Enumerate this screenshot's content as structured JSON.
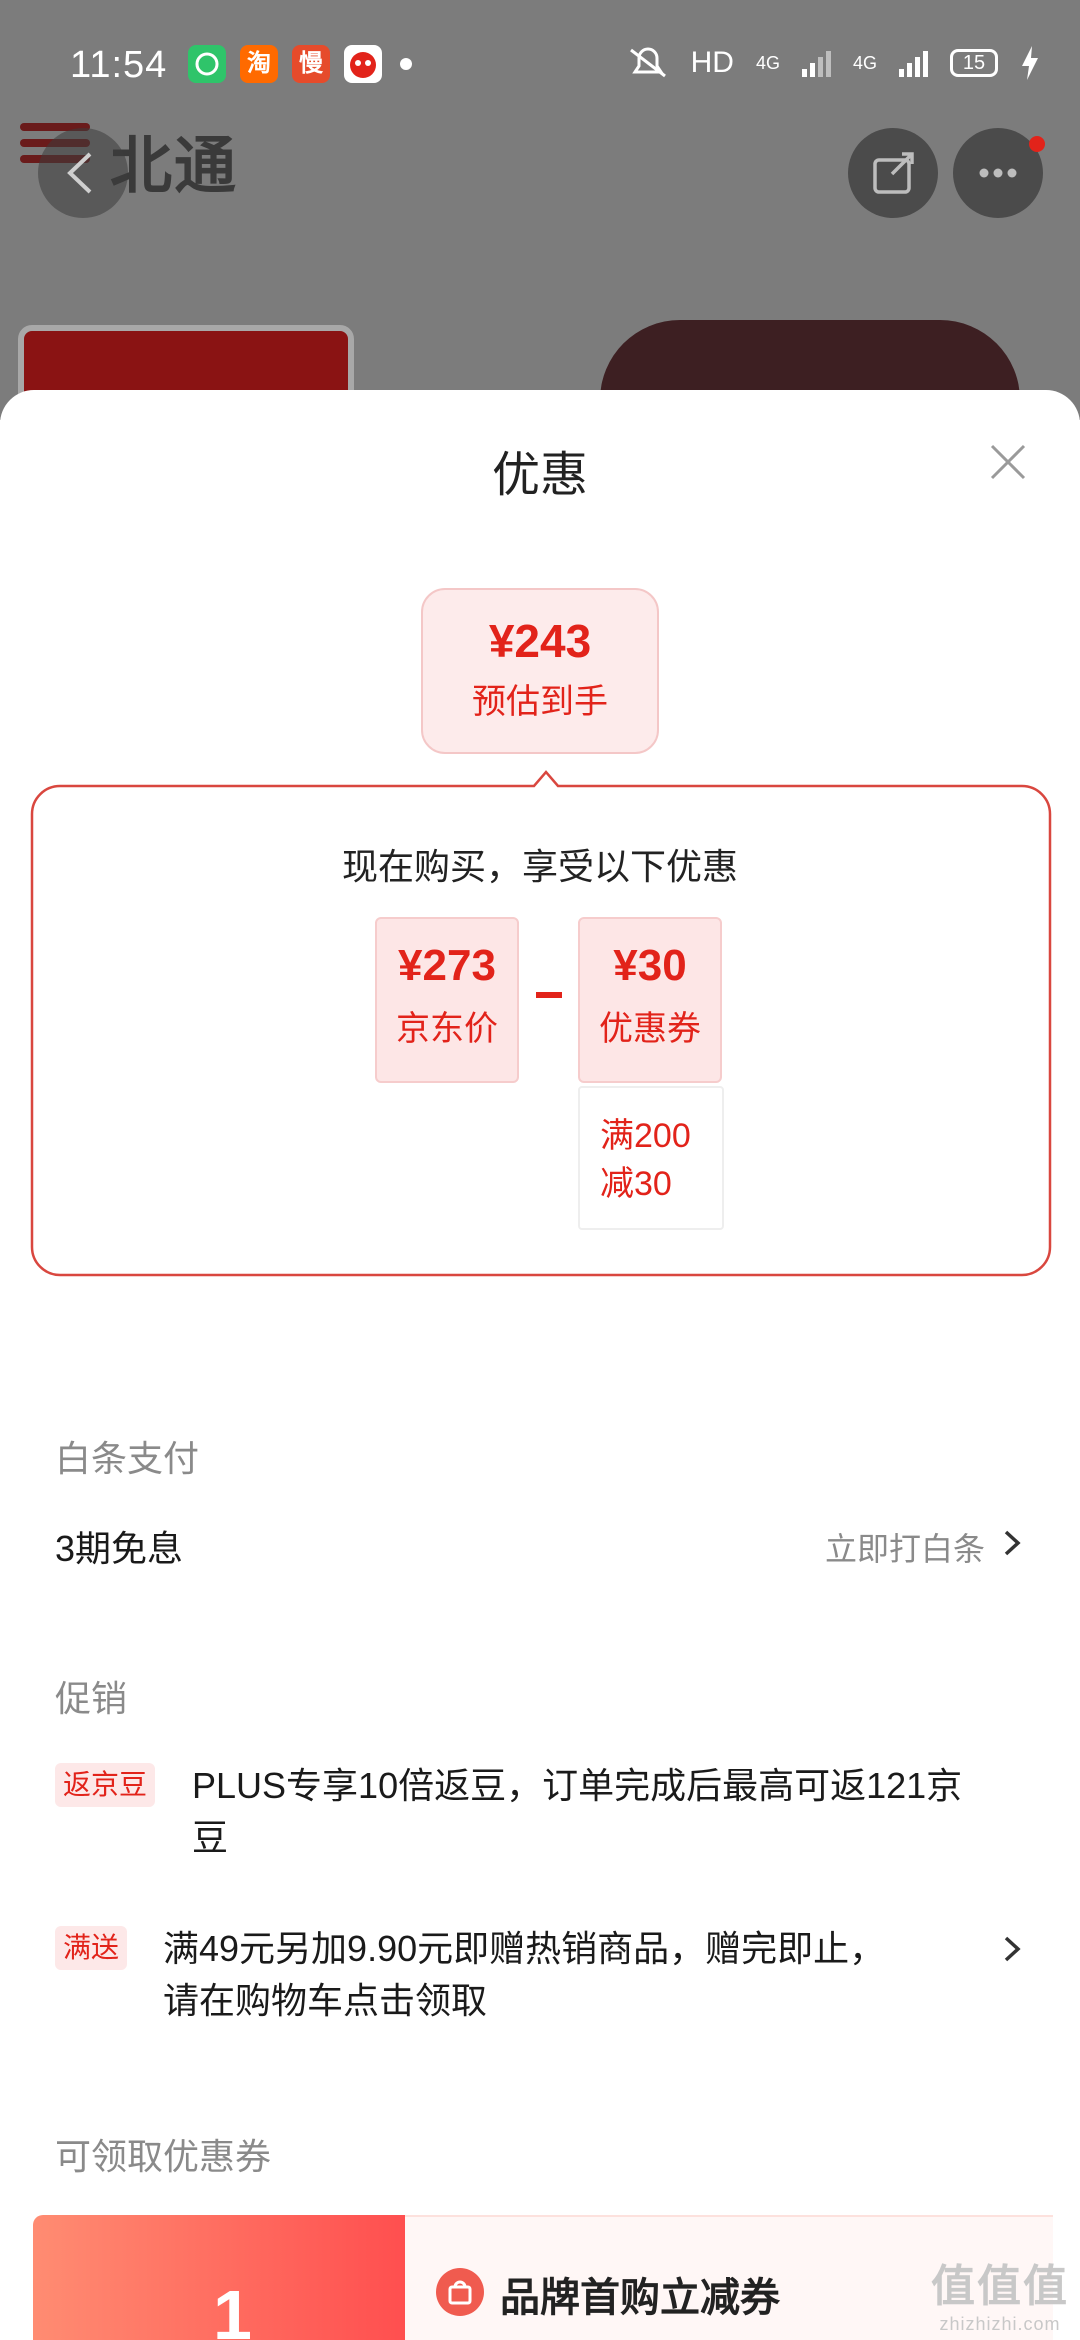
{
  "status_bar": {
    "time": "11:54",
    "apps": [
      "wechat-icon",
      "taobao-icon",
      "app-icon",
      "jd-mascot-icon"
    ],
    "app_badge_text": [
      "淘",
      "慢"
    ],
    "network": "HD",
    "net_type_1": "4G",
    "net_type_2": "4G",
    "battery": "15"
  },
  "background_page": {
    "brand_name": "北通"
  },
  "sheet": {
    "title": "优惠",
    "estimate": {
      "price": "¥243",
      "label": "预估到手"
    },
    "calc_title": "现在购买，享受以下优惠",
    "jd_price": {
      "value": "¥273",
      "label": "京东价"
    },
    "coupon": {
      "value": "¥30",
      "label": "优惠券",
      "condition_line1": "满200",
      "condition_line2": "减30"
    },
    "baitiao": {
      "section": "白条支付",
      "item": "3期免息",
      "action": "立即打白条"
    },
    "promotion": {
      "section": "促销",
      "items": [
        {
          "tag": "返京豆",
          "line1": "PLUS专享10倍返豆，订单完成后最高可返121京",
          "line2": "豆"
        },
        {
          "tag": "满送",
          "line1": "满49元另加9.90元即赠热销商品，赠完即止，",
          "line2": "请在购物车点击领取"
        }
      ]
    },
    "coupons": {
      "section": "可领取优惠券",
      "first_amount": "1",
      "first_title": "品牌首购立减券"
    }
  },
  "watermark": {
    "main": "值值值",
    "sub": "zhizhizhi.com"
  }
}
